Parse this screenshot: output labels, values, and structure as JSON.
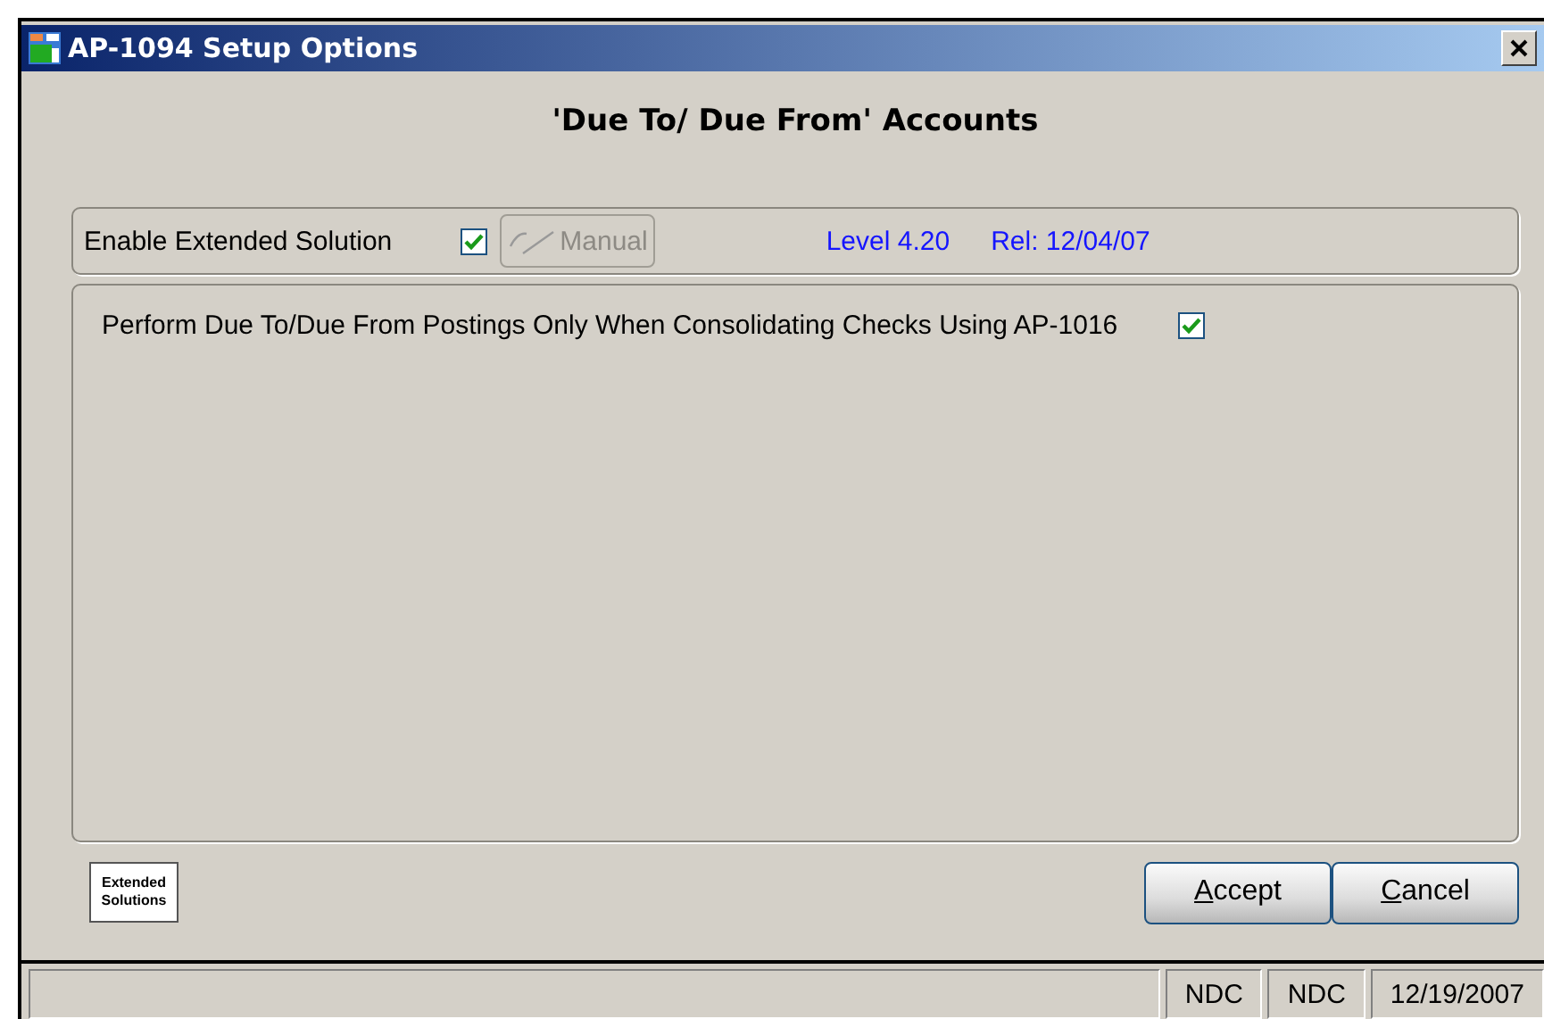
{
  "window": {
    "title": "AP-1094 Setup Options"
  },
  "heading": "'Due To/ Due From' Accounts",
  "enable": {
    "label": "Enable Extended Solution",
    "checked": true
  },
  "manual_button": {
    "label": "Manual",
    "disabled": true
  },
  "level": "Level 4.20",
  "release": "Rel: 12/04/07",
  "option": {
    "label": "Perform Due To/Due From Postings Only When Consolidating Checks Using AP-1016",
    "checked": true
  },
  "logo": {
    "line_1": "Extended",
    "line_2": "Solutions"
  },
  "buttons": [
    {
      "access_key": "A",
      "label_rest": "ccept"
    },
    {
      "access_key": "C",
      "label_rest": "ancel"
    }
  ],
  "status_bar": [
    "NDC",
    "NDC",
    "12/19/2007"
  ]
}
